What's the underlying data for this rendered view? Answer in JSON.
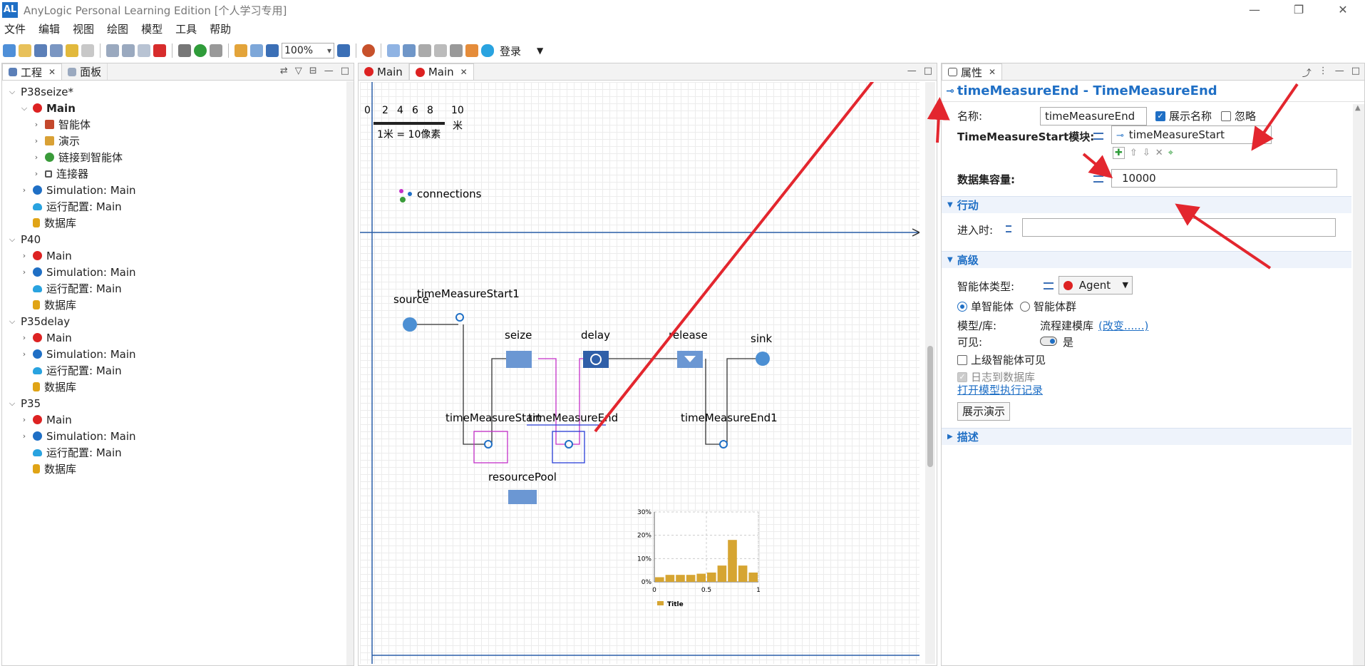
{
  "app": {
    "title": "AnyLogic Personal Learning Edition [个人学习专用]",
    "icon_label": "AL",
    "win_minimize": "—",
    "win_restore": "❐",
    "win_close": "✕"
  },
  "menu": [
    "文件",
    "编辑",
    "视图",
    "绘图",
    "模型",
    "工具",
    "帮助"
  ],
  "toolbar": {
    "zoom": "100%",
    "login": "登录"
  },
  "project_panel": {
    "tabs": [
      {
        "label": "工程"
      },
      {
        "label": "面板"
      }
    ],
    "tree": [
      {
        "label": "P38seize*",
        "level": 0,
        "caret": "v",
        "icon": "none",
        "bold": false
      },
      {
        "label": "Main",
        "level": 1,
        "caret": "v",
        "icon": "agent",
        "bold": true
      },
      {
        "label": "智能体",
        "level": 2,
        "caret": ">",
        "icon": "folder",
        "bold": false
      },
      {
        "label": "演示",
        "level": 2,
        "caret": ">",
        "icon": "demo",
        "bold": false
      },
      {
        "label": "链接到智能体",
        "level": 2,
        "caret": ">",
        "icon": "link",
        "bold": false
      },
      {
        "label": "连接器",
        "level": 2,
        "caret": ">",
        "icon": "conn",
        "bold": false
      },
      {
        "label": "Simulation: Main",
        "level": 1,
        "caret": ">",
        "icon": "sim",
        "bold": false
      },
      {
        "label": "运行配置: Main",
        "level": 1,
        "caret": "",
        "icon": "cloud",
        "bold": false
      },
      {
        "label": "数据库",
        "level": 1,
        "caret": "",
        "icon": "db",
        "bold": false
      },
      {
        "label": "P40",
        "level": 0,
        "caret": "v",
        "icon": "none",
        "bold": false
      },
      {
        "label": "Main",
        "level": 1,
        "caret": ">",
        "icon": "agent",
        "bold": false
      },
      {
        "label": "Simulation: Main",
        "level": 1,
        "caret": ">",
        "icon": "sim",
        "bold": false
      },
      {
        "label": "运行配置: Main",
        "level": 1,
        "caret": "",
        "icon": "cloud",
        "bold": false
      },
      {
        "label": "数据库",
        "level": 1,
        "caret": "",
        "icon": "db",
        "bold": false
      },
      {
        "label": "P35delay",
        "level": 0,
        "caret": "v",
        "icon": "none",
        "bold": false
      },
      {
        "label": "Main",
        "level": 1,
        "caret": ">",
        "icon": "agent",
        "bold": false
      },
      {
        "label": "Simulation: Main",
        "level": 1,
        "caret": ">",
        "icon": "sim",
        "bold": false
      },
      {
        "label": "运行配置: Main",
        "level": 1,
        "caret": "",
        "icon": "cloud",
        "bold": false
      },
      {
        "label": "数据库",
        "level": 1,
        "caret": "",
        "icon": "db",
        "bold": false
      },
      {
        "label": "P35",
        "level": 0,
        "caret": "v",
        "icon": "none",
        "bold": false
      },
      {
        "label": "Main",
        "level": 1,
        "caret": ">",
        "icon": "agent",
        "bold": false
      },
      {
        "label": "Simulation: Main",
        "level": 1,
        "caret": ">",
        "icon": "sim",
        "bold": false
      },
      {
        "label": "运行配置: Main",
        "level": 1,
        "caret": "",
        "icon": "cloud",
        "bold": false
      },
      {
        "label": "数据库",
        "level": 1,
        "caret": "",
        "icon": "db",
        "bold": false
      }
    ]
  },
  "editor": {
    "tabs": [
      {
        "label": "Main",
        "active": false
      },
      {
        "label": "Main",
        "active": true
      }
    ],
    "scale": {
      "ticks": [
        "0",
        "2",
        "4",
        "6",
        "8",
        "10"
      ],
      "unit": "米",
      "caption": "1米 = 10像素"
    },
    "labels": {
      "connections": "connections",
      "source": "source",
      "tms1": "timeMeasureStart1",
      "seize": "seize",
      "delay": "delay",
      "release": "release",
      "sink": "sink",
      "tms": "timeMeasureStart",
      "tme": "timeMeasureEnd",
      "tme1": "timeMeasureEnd1",
      "pool": "resourcePool"
    }
  },
  "chart_data": {
    "type": "bar",
    "x": [
      0.05,
      0.15,
      0.25,
      0.35,
      0.45,
      0.55,
      0.65,
      0.75,
      0.85,
      0.95
    ],
    "values": [
      0.02,
      0.03,
      0.03,
      0.03,
      0.035,
      0.04,
      0.07,
      0.18,
      0.07,
      0.04
    ],
    "y_ticks": [
      "0%",
      "10%",
      "20%",
      "30%"
    ],
    "x_ticks": [
      "0",
      "0.5",
      "1"
    ],
    "ylim": [
      0,
      0.3
    ],
    "xlim": [
      0,
      1
    ],
    "legend": "Title",
    "bar_color": "#d6a532"
  },
  "properties": {
    "tab": "属性",
    "header": "timeMeasureEnd - TimeMeasureEnd",
    "name_label": "名称:",
    "name_value": "timeMeasureEnd",
    "show_name": "展示名称",
    "ignore": "忽略",
    "tms_label": "TimeMeasureStart模块:",
    "tms_value": "timeMeasureStart",
    "capacity_label": "数据集容量:",
    "capacity_value": "10000",
    "section_action": "行动",
    "on_enter_label": "进入时:",
    "section_advanced": "高级",
    "agent_type_label": "智能体类型:",
    "agent_type_value": "Agent",
    "single_agent": "单智能体",
    "population": "智能体群",
    "model_lib_label": "模型/库:",
    "model_lib_value": "流程建模库",
    "change_link": "(改变......)",
    "visible_label": "可见:",
    "visible_value": "是",
    "upper_visible": "上级智能体可见",
    "log_db": "日志到数据库",
    "open_log": "打开模型执行记录",
    "show_demo": "展示演示",
    "section_desc": "描述"
  },
  "colors": {
    "accent": "#1f6fc5",
    "arrow": "#e3262e",
    "block": "#6b97d3",
    "selected_magenta": "#c42fc8"
  }
}
